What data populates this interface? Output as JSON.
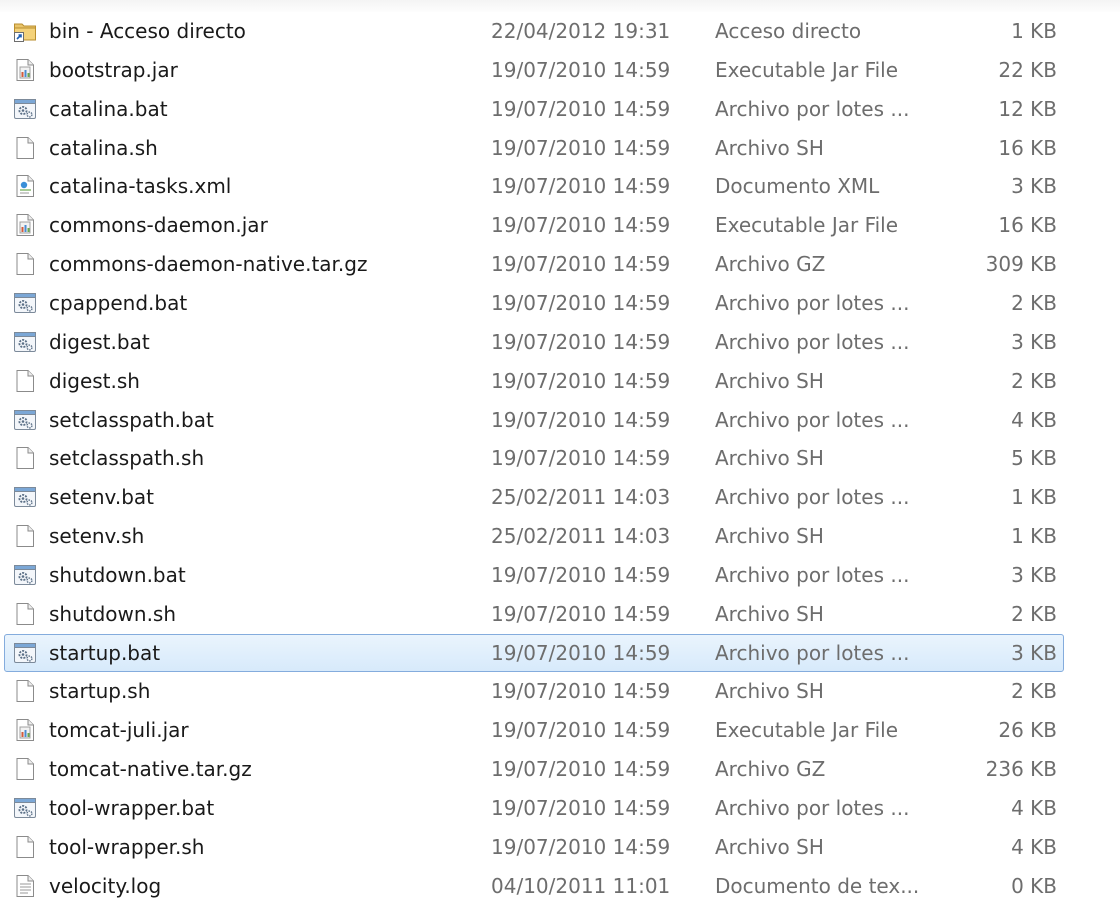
{
  "files": [
    {
      "name": "bin - Acceso directo",
      "date": "22/04/2012 19:31",
      "type": "Acceso directo",
      "size": "1 KB",
      "icon": "shortcut-folder-icon"
    },
    {
      "name": "bootstrap.jar",
      "date": "19/07/2010 14:59",
      "type": "Executable Jar File",
      "size": "22 KB",
      "icon": "jar-file-icon"
    },
    {
      "name": "catalina.bat",
      "date": "19/07/2010 14:59",
      "type": "Archivo por lotes ...",
      "size": "12 KB",
      "icon": "batch-file-icon"
    },
    {
      "name": "catalina.sh",
      "date": "19/07/2010 14:59",
      "type": "Archivo SH",
      "size": "16 KB",
      "icon": "blank-file-icon"
    },
    {
      "name": "catalina-tasks.xml",
      "date": "19/07/2010 14:59",
      "type": "Documento XML",
      "size": "3 KB",
      "icon": "xml-file-icon"
    },
    {
      "name": "commons-daemon.jar",
      "date": "19/07/2010 14:59",
      "type": "Executable Jar File",
      "size": "16 KB",
      "icon": "jar-file-icon"
    },
    {
      "name": "commons-daemon-native.tar.gz",
      "date": "19/07/2010 14:59",
      "type": "Archivo GZ",
      "size": "309 KB",
      "icon": "blank-file-icon"
    },
    {
      "name": "cpappend.bat",
      "date": "19/07/2010 14:59",
      "type": "Archivo por lotes ...",
      "size": "2 KB",
      "icon": "batch-file-icon"
    },
    {
      "name": "digest.bat",
      "date": "19/07/2010 14:59",
      "type": "Archivo por lotes ...",
      "size": "3 KB",
      "icon": "batch-file-icon"
    },
    {
      "name": "digest.sh",
      "date": "19/07/2010 14:59",
      "type": "Archivo SH",
      "size": "2 KB",
      "icon": "blank-file-icon"
    },
    {
      "name": "setclasspath.bat",
      "date": "19/07/2010 14:59",
      "type": "Archivo por lotes ...",
      "size": "4 KB",
      "icon": "batch-file-icon"
    },
    {
      "name": "setclasspath.sh",
      "date": "19/07/2010 14:59",
      "type": "Archivo SH",
      "size": "5 KB",
      "icon": "blank-file-icon"
    },
    {
      "name": "setenv.bat",
      "date": "25/02/2011 14:03",
      "type": "Archivo por lotes ...",
      "size": "1 KB",
      "icon": "batch-file-icon"
    },
    {
      "name": "setenv.sh",
      "date": "25/02/2011 14:03",
      "type": "Archivo SH",
      "size": "1 KB",
      "icon": "blank-file-icon"
    },
    {
      "name": "shutdown.bat",
      "date": "19/07/2010 14:59",
      "type": "Archivo por lotes ...",
      "size": "3 KB",
      "icon": "batch-file-icon"
    },
    {
      "name": "shutdown.sh",
      "date": "19/07/2010 14:59",
      "type": "Archivo SH",
      "size": "2 KB",
      "icon": "blank-file-icon"
    },
    {
      "name": "startup.bat",
      "date": "19/07/2010 14:59",
      "type": "Archivo por lotes ...",
      "size": "3 KB",
      "icon": "batch-file-icon",
      "selected": true
    },
    {
      "name": "startup.sh",
      "date": "19/07/2010 14:59",
      "type": "Archivo SH",
      "size": "2 KB",
      "icon": "blank-file-icon"
    },
    {
      "name": "tomcat-juli.jar",
      "date": "19/07/2010 14:59",
      "type": "Executable Jar File",
      "size": "26 KB",
      "icon": "jar-file-icon"
    },
    {
      "name": "tomcat-native.tar.gz",
      "date": "19/07/2010 14:59",
      "type": "Archivo GZ",
      "size": "236 KB",
      "icon": "blank-file-icon"
    },
    {
      "name": "tool-wrapper.bat",
      "date": "19/07/2010 14:59",
      "type": "Archivo por lotes ...",
      "size": "4 KB",
      "icon": "batch-file-icon"
    },
    {
      "name": "tool-wrapper.sh",
      "date": "19/07/2010 14:59",
      "type": "Archivo SH",
      "size": "4 KB",
      "icon": "blank-file-icon"
    },
    {
      "name": "velocity.log",
      "date": "04/10/2011 11:01",
      "type": "Documento de tex...",
      "size": "0 KB",
      "icon": "text-file-icon"
    }
  ],
  "colors": {
    "selection_fill": "#dcebfc",
    "selection_border": "#84acdd",
    "name_text": "#1a1a1a",
    "detail_text": "#6d6d6d"
  }
}
